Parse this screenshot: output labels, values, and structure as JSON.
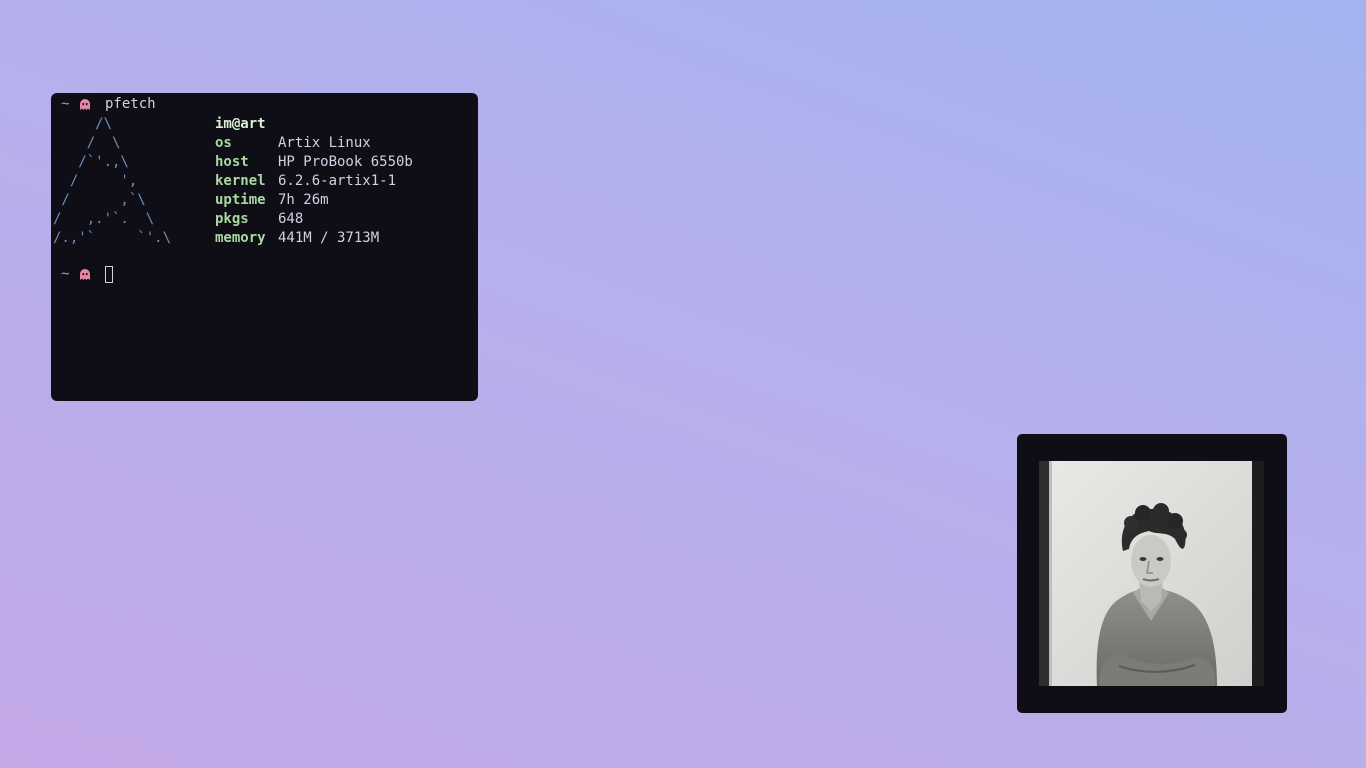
{
  "terminal": {
    "prompt_symbol": "~",
    "command": "pfetch",
    "ascii_art": "     /\\\n    /  \\\n   /`'.,\\\n  /     ',\n /      ,`\\\n/   ,.'`.  \\\n/.,'`     `'.\\",
    "user_host": "im@art",
    "info": [
      {
        "key": "os",
        "value": "Artix Linux"
      },
      {
        "key": "host",
        "value": "HP ProBook 6550b"
      },
      {
        "key": "kernel",
        "value": "6.2.6-artix1-1"
      },
      {
        "key": "uptime",
        "value": "7h 26m"
      },
      {
        "key": "pkgs",
        "value": "648"
      },
      {
        "key": "memory",
        "value": "441M / 3713M"
      }
    ]
  },
  "image_viewer": {
    "subject": "black-and-white portrait photo"
  },
  "colors": {
    "terminal_bg": "#0f0e17",
    "info_key": "#a8d9a0",
    "ascii": "#6c8fbf",
    "prompt_tilde": "#d58a8a",
    "ghost": "#e58aa6"
  }
}
